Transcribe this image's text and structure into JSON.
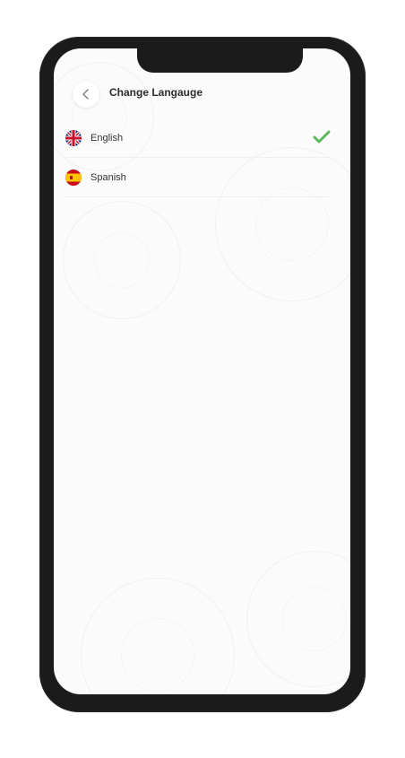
{
  "header": {
    "title": "Change Langauge",
    "back_icon": "chevron-left-icon"
  },
  "languages": [
    {
      "label": "English",
      "flag": "uk-flag-icon",
      "selected": true
    },
    {
      "label": "Spanish",
      "flag": "spain-flag-icon",
      "selected": false
    }
  ],
  "colors": {
    "check": "#5cb85c",
    "screen_background": "#fbfbfb",
    "frame": "#1b1b1c"
  }
}
